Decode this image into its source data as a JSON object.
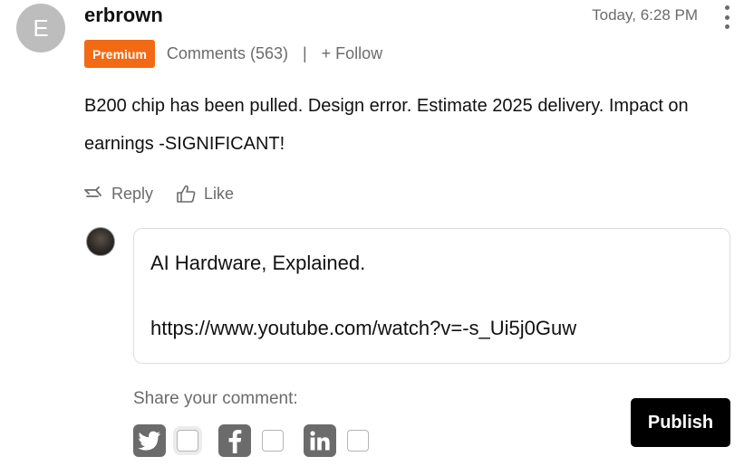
{
  "comment": {
    "avatar_initial": "E",
    "username": "erbrown",
    "timestamp": "Today, 6:28 PM",
    "badge": "Premium",
    "comments_link": "Comments (563)",
    "separator": "|",
    "follow_label": "+ Follow",
    "body": "B200 chip has been pulled. Design error. Estimate 2025 delivery. Impact on earnings -SIGNIFICANT!",
    "reply_label": "Reply",
    "like_label": "Like",
    "icons": {
      "more": "more-vertical-icon",
      "reply": "reply-arrow-icon",
      "like": "thumbs-up-icon"
    }
  },
  "reply_box": {
    "line1": "AI Hardware, Explained.",
    "line2": "https://www.youtube.com/watch?v=-s_Ui5j0Guw"
  },
  "share": {
    "label": "Share your comment:",
    "networks": [
      {
        "name": "Twitter",
        "icon": "twitter-icon",
        "checked": false
      },
      {
        "name": "Facebook",
        "icon": "facebook-icon",
        "checked": false
      },
      {
        "name": "LinkedIn",
        "icon": "linkedin-icon",
        "checked": false
      }
    ]
  },
  "publish_label": "Publish",
  "colors": {
    "badge": "#f26a14",
    "muted_text": "#6b6b6b",
    "publish_bg": "#000000",
    "avatar_bg": "#bdbdbd"
  }
}
